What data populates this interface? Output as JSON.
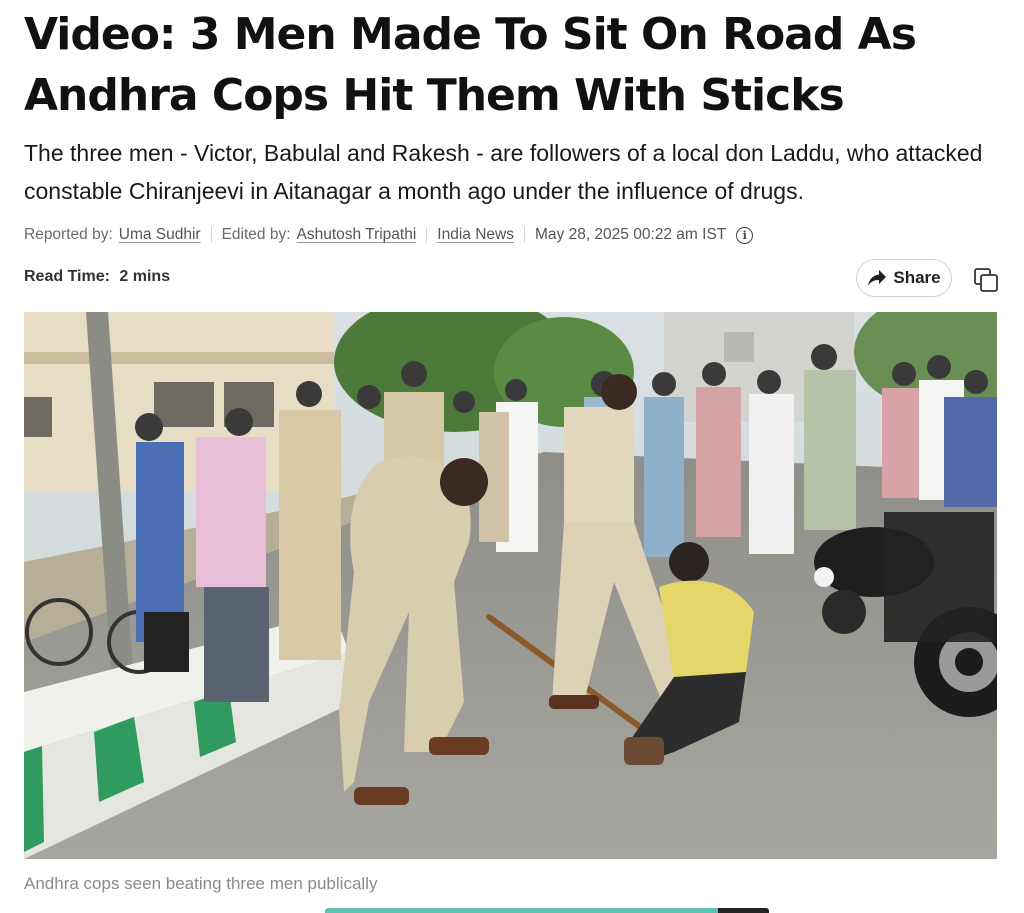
{
  "article": {
    "headline": "Video: 3 Men Made To Sit On Road As Andhra Cops Hit Them With Sticks",
    "summary": "The three men - Victor, Babulal and Rakesh - are followers of a local don Laddu, who attacked constable Chiranjeevi in Aitanagar a month ago under the influence of drugs.",
    "byline": {
      "reported_label": "Reported by:",
      "reporter": "Uma Sudhir",
      "edited_label": "Edited by:",
      "editor": "Ashutosh Tripathi",
      "section": "India News",
      "timestamp": "May 28, 2025 00:22 am IST",
      "info_icon": "info-icon"
    },
    "read_time": {
      "label": "Read Time:",
      "value": "2 mins"
    },
    "actions": {
      "share_label": "Share",
      "share_icon": "share-arrow-icon",
      "copy_icon": "copy-icon"
    },
    "image": {
      "caption": "Andhra cops seen beating three men publically"
    }
  },
  "colors": {
    "bottom_bar_accent": "#5fbfb0",
    "bottom_bar_dark": "#222222",
    "link": "#555555"
  }
}
